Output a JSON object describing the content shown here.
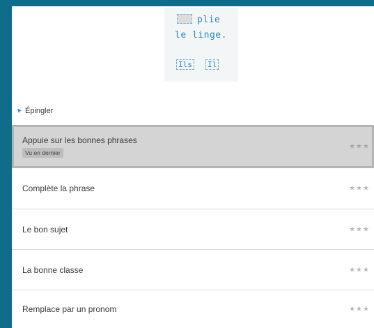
{
  "preview": {
    "line1": "plie",
    "line2": "le linge.",
    "option1": "Ils",
    "option2": "Il"
  },
  "pin": {
    "label": "Épingler",
    "icon": "pin-icon"
  },
  "exercises": [
    {
      "label": "Appuie sur les bonnes phrases",
      "badge": "Vu en dernier",
      "rating": "★★★",
      "rating_value": 0
    },
    {
      "label": "Complète la phrase",
      "rating": "★★★",
      "rating_value": 0
    },
    {
      "label": "Le bon sujet",
      "rating": "★★★",
      "rating_value": 0
    },
    {
      "label": "La bonne classe",
      "rating": "★★★",
      "rating_value": 0
    },
    {
      "label": "Remplace par un pronom",
      "rating": "★★★",
      "rating_value": 0
    }
  ],
  "colors": {
    "background": "#0e6e8a",
    "accent": "#2f86c9",
    "selected_row": "#d4d4d4"
  }
}
